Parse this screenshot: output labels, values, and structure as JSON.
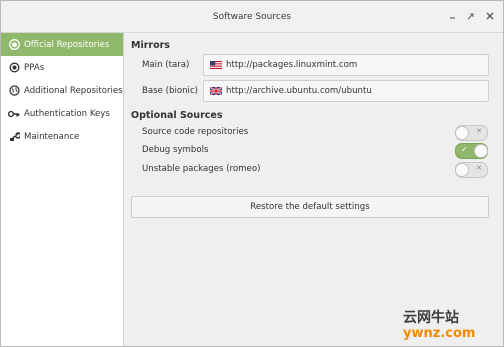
{
  "window": {
    "title": "Software Sources"
  },
  "sidebar": {
    "items": [
      {
        "label": "Official Repositories",
        "icon": "package-icon",
        "active": true
      },
      {
        "label": "PPAs",
        "icon": "radio-icon",
        "active": false
      },
      {
        "label": "Additional Repositories",
        "icon": "globe-icon",
        "active": false
      },
      {
        "label": "Authentication Keys",
        "icon": "key-icon",
        "active": false
      },
      {
        "label": "Maintenance",
        "icon": "wrench-icon",
        "active": false
      }
    ]
  },
  "mirrors": {
    "heading": "Mirrors",
    "main": {
      "label": "Main (tara)",
      "url": "http://packages.linuxmint.com",
      "flag": "us-flag-icon"
    },
    "base": {
      "label": "Base (bionic)",
      "url": "http://archive.ubuntu.com/ubuntu",
      "flag": "uk-flag-icon"
    }
  },
  "optional_sources": {
    "heading": "Optional Sources",
    "items": [
      {
        "label": "Source code repositories",
        "on": false
      },
      {
        "label": "Debug symbols",
        "on": true
      },
      {
        "label": "Unstable packages (romeo)",
        "on": false
      }
    ]
  },
  "restore_button": "Restore the default settings",
  "watermark": {
    "line1": "云网牛站",
    "line2": "ywnz.com"
  },
  "colors": {
    "accent": "#8fb86a",
    "watermark_orange": "#f08a00"
  }
}
